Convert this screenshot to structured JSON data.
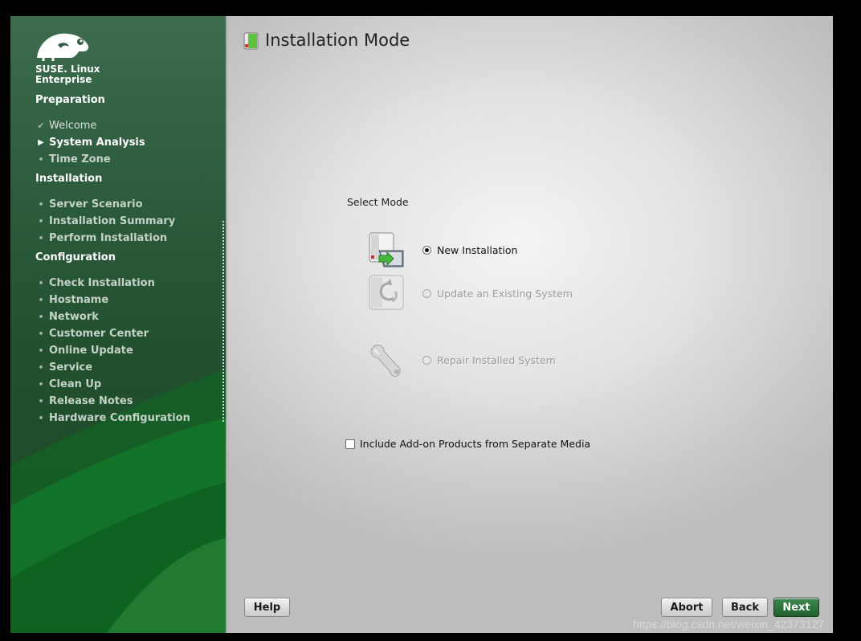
{
  "brand": {
    "line1": "SUSE. Linux",
    "line2": "Enterprise"
  },
  "sidebar": {
    "sections": [
      {
        "title": "Preparation",
        "steps": [
          {
            "label": "Welcome",
            "state": "done"
          },
          {
            "label": "System Analysis",
            "state": "active"
          },
          {
            "label": "Time Zone",
            "state": "todo"
          }
        ]
      },
      {
        "title": "Installation",
        "steps": [
          {
            "label": "Server Scenario",
            "state": "todo"
          },
          {
            "label": "Installation Summary",
            "state": "todo"
          },
          {
            "label": "Perform Installation",
            "state": "todo"
          }
        ]
      },
      {
        "title": "Configuration",
        "steps": [
          {
            "label": "Check Installation",
            "state": "todo"
          },
          {
            "label": "Hostname",
            "state": "todo"
          },
          {
            "label": "Network",
            "state": "todo"
          },
          {
            "label": "Customer Center",
            "state": "todo"
          },
          {
            "label": "Online Update",
            "state": "todo"
          },
          {
            "label": "Service",
            "state": "todo"
          },
          {
            "label": "Clean Up",
            "state": "todo"
          },
          {
            "label": "Release Notes",
            "state": "todo"
          },
          {
            "label": "Hardware Configuration",
            "state": "todo"
          }
        ]
      }
    ]
  },
  "main": {
    "title": "Installation Mode",
    "select_mode_label": "Select Mode",
    "modes": [
      {
        "label": "New Installation",
        "selected": true,
        "enabled": true,
        "icon": "new-installation-icon"
      },
      {
        "label": "Update an Existing System",
        "selected": false,
        "enabled": false,
        "icon": "update-system-icon"
      },
      {
        "label": "Repair Installed System",
        "selected": false,
        "enabled": false,
        "icon": "repair-wrench-icon"
      }
    ],
    "addon_checkbox": {
      "label": "Include Add-on Products from Separate Media",
      "checked": false
    }
  },
  "buttons": {
    "help": "Help",
    "abort": "Abort",
    "back": "Back",
    "next": "Next"
  },
  "watermark": "https://blog.csdn.net/weixin_42373127",
  "colors": {
    "sidebar_green": "#1f5a2e",
    "next_button": "#2b6f3a"
  }
}
